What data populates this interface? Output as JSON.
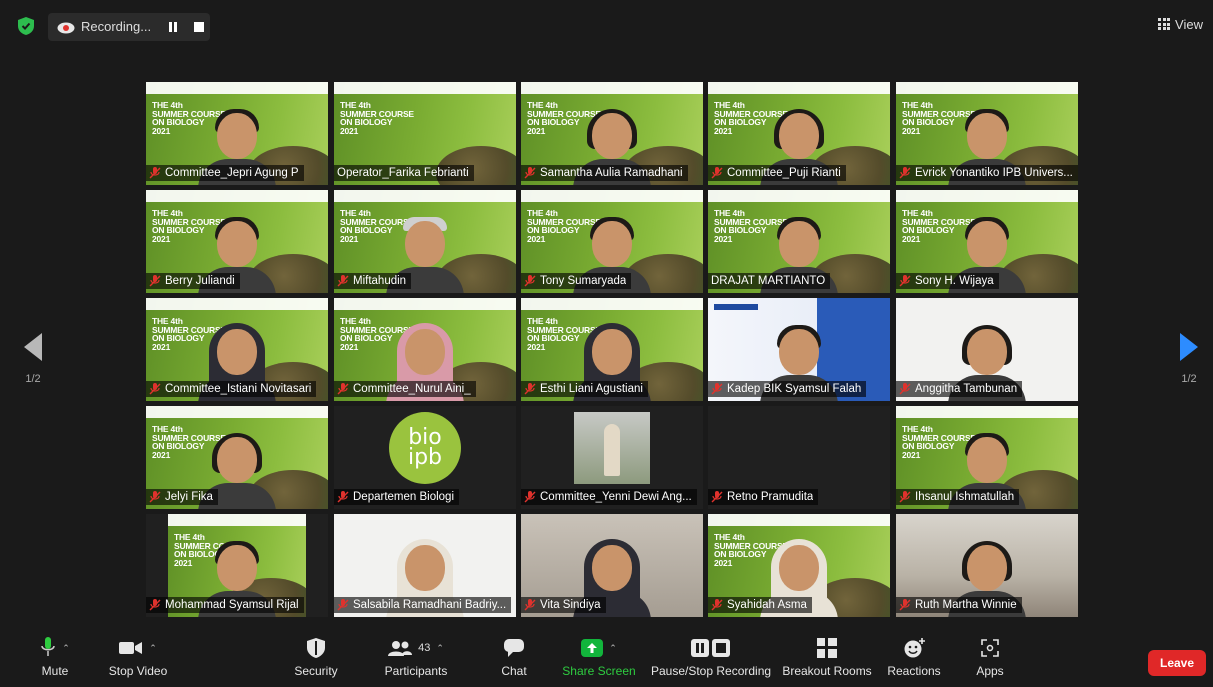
{
  "topbar": {
    "recording_label": "Recording...",
    "view_label": "View"
  },
  "pager": {
    "left_page": "1/2",
    "right_page": "1/2"
  },
  "participants": [
    {
      "name": "Committee_Jepri Agung P",
      "muted": true
    },
    {
      "name": "Operator_Farika Febrianti",
      "muted": false,
      "active_speaker": true
    },
    {
      "name": "Samantha Aulia Ramadhani",
      "muted": true
    },
    {
      "name": "Committee_Puji Rianti",
      "muted": true
    },
    {
      "name": "Evrick Yonantiko IPB Univers...",
      "muted": true
    },
    {
      "name": "Berry Juliandi",
      "muted": true
    },
    {
      "name": "Miftahudin",
      "muted": true
    },
    {
      "name": "Tony Sumaryada",
      "muted": true
    },
    {
      "name": "DRAJAT MARTIANTO",
      "muted": false
    },
    {
      "name": "Sony H. Wijaya",
      "muted": true
    },
    {
      "name": "Committee_Istiani Novitasari",
      "muted": true
    },
    {
      "name": "Committee_Nurul Aini_",
      "muted": true
    },
    {
      "name": "Esthi Liani Agustiani",
      "muted": true
    },
    {
      "name": "Kadep BIK Syamsul Falah",
      "muted": true
    },
    {
      "name": "Anggitha Tambunan",
      "muted": true
    },
    {
      "name": "Jelyi Fika",
      "muted": true
    },
    {
      "name": "Departemen Biologi",
      "muted": true
    },
    {
      "name": "Committee_Yenni Dewi Ang...",
      "muted": true
    },
    {
      "name": "Retno Pramudita",
      "muted": true
    },
    {
      "name": "Ihsanul Ishmatullah",
      "muted": true
    },
    {
      "name": "Mohammad Syamsul Rijal",
      "muted": true
    },
    {
      "name": "Salsabila Ramadhani Badriy...",
      "muted": true
    },
    {
      "name": "Vita Sindiya",
      "muted": true
    },
    {
      "name": "Syahidah Asma",
      "muted": true
    },
    {
      "name": "Ruth Martha Winnie",
      "muted": true
    }
  ],
  "banner": {
    "line1": "THE 4th",
    "line2": "SUMMER COURSE",
    "line3": "ON BIOLOGY",
    "line4": "2021"
  },
  "logo": {
    "line1": "bio",
    "line2": "ipb"
  },
  "toolbar": {
    "mute": "Mute",
    "stop_video": "Stop Video",
    "security": "Security",
    "participants": "Participants",
    "participants_count": "43",
    "chat": "Chat",
    "share_screen": "Share Screen",
    "pause_stop_recording": "Pause/Stop Recording",
    "breakout_rooms": "Breakout Rooms",
    "reactions": "Reactions",
    "apps": "Apps",
    "leave": "Leave"
  },
  "colors": {
    "background": "#1a1a1a",
    "share_green": "#12b53c",
    "leave_red": "#e02828",
    "pager_blue": "#2d8cff",
    "active_border": "#b7d03a",
    "muted_red": "#e0322d"
  }
}
